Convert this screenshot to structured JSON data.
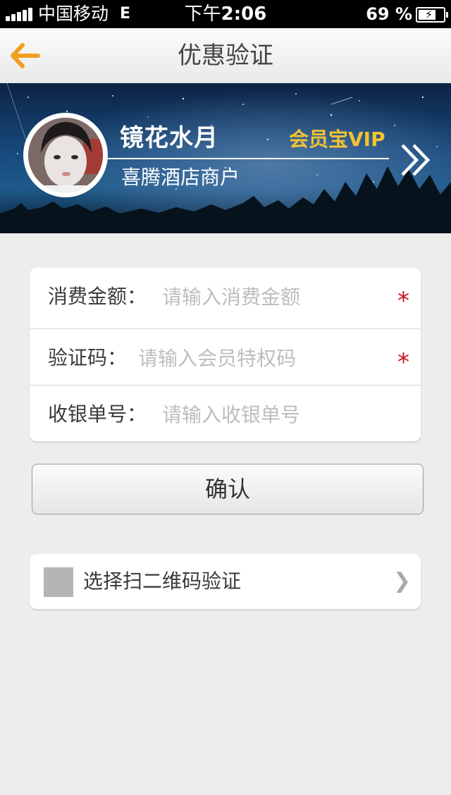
{
  "status_bar": {
    "carrier": "中国移动",
    "network": "E",
    "time_prefix": "下午",
    "time": "2:06",
    "battery_percent": "69 %"
  },
  "nav": {
    "title": "优惠验证",
    "back_icon": "back-arrow-icon"
  },
  "banner": {
    "user_name": "镜花水月",
    "vip_label": "会员宝VIP",
    "merchant": "喜腾酒店商户",
    "forward_icon": "double-chevron-right-icon"
  },
  "form": {
    "fields": [
      {
        "label": "消费金额：",
        "placeholder": "请输入消费金额",
        "value": "",
        "required": "*"
      },
      {
        "label": "验证码：",
        "placeholder": "请输入会员特权码",
        "value": "",
        "required": "*"
      },
      {
        "label": "收银单号：",
        "placeholder": "请输入收银单号",
        "value": ""
      }
    ]
  },
  "confirm_label": "确认",
  "qr_option": {
    "label": "选择扫二维码验证",
    "chevron": "❯",
    "checked": false
  },
  "colors": {
    "accent_orange": "#f0a01e",
    "vip_gold": "#f2c331",
    "required_red": "#c8141b",
    "background": "#ededed"
  }
}
